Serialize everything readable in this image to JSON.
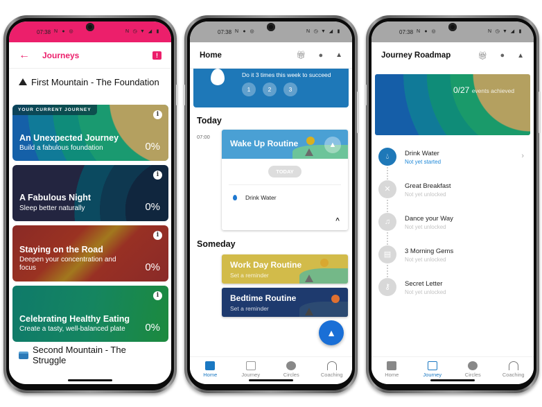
{
  "status_bar": {
    "time": "07:38"
  },
  "screen1": {
    "title": "Journeys",
    "first_mountain": "First Mountain - The Foundation",
    "second_mountain": "Second Mountain - The Struggle",
    "current_badge": "YOUR CURRENT JOURNEY",
    "journeys": [
      {
        "title": "An Unexpected Journey",
        "subtitle": "Build a fabulous foundation",
        "progress": "0%"
      },
      {
        "title": "A Fabulous Night",
        "subtitle": "Sleep better naturally",
        "progress": "0%"
      },
      {
        "title": "Staying on the Road",
        "subtitle": "Deepen your concentration and focus",
        "progress": "0%"
      },
      {
        "title": "Celebrating Healthy Eating",
        "subtitle": "Create a tasty, well-balanced plate",
        "progress": "0%"
      }
    ]
  },
  "screen2": {
    "title": "Home",
    "banner_message": "Do it 3 times this week to succeed",
    "banner_steps": [
      "1",
      "2",
      "3"
    ],
    "today_heading": "Today",
    "someday_heading": "Someday",
    "wake_time": "07:00",
    "wake_routine": "Wake Up Routine",
    "today_pill": "TODAY",
    "habit": "Drink Water",
    "work_routine": {
      "title": "Work Day Routine",
      "subtitle": "Set a reminder"
    },
    "bed_routine": {
      "title": "Bedtime Routine",
      "subtitle": "Set a reminder"
    }
  },
  "screen3": {
    "title": "Journey Roadmap",
    "achieved_count": "0/27",
    "achieved_label": "events achieved",
    "steps": [
      {
        "title": "Drink Water",
        "status": "Not yet started",
        "icon": "drop-icon",
        "glyph": "💧"
      },
      {
        "title": "Great Breakfast",
        "status": "Not yet unlocked",
        "icon": "utensils-icon",
        "glyph": "✕"
      },
      {
        "title": "Dance your Way",
        "status": "Not yet unlocked",
        "icon": "dance-icon",
        "glyph": "♫"
      },
      {
        "title": "3 Morning Gems",
        "status": "Not yet unlocked",
        "icon": "scroll-icon",
        "glyph": "▤"
      },
      {
        "title": "Secret Letter",
        "status": "Not yet unlocked",
        "icon": "key-icon",
        "glyph": "⚷"
      }
    ]
  },
  "bottom_nav": [
    "Home",
    "Journey",
    "Circles",
    "Coaching"
  ],
  "colors": {
    "brand_pink": "#ec1f6b",
    "primary_blue": "#1e78b8",
    "active_nav": "#1a78c2"
  }
}
